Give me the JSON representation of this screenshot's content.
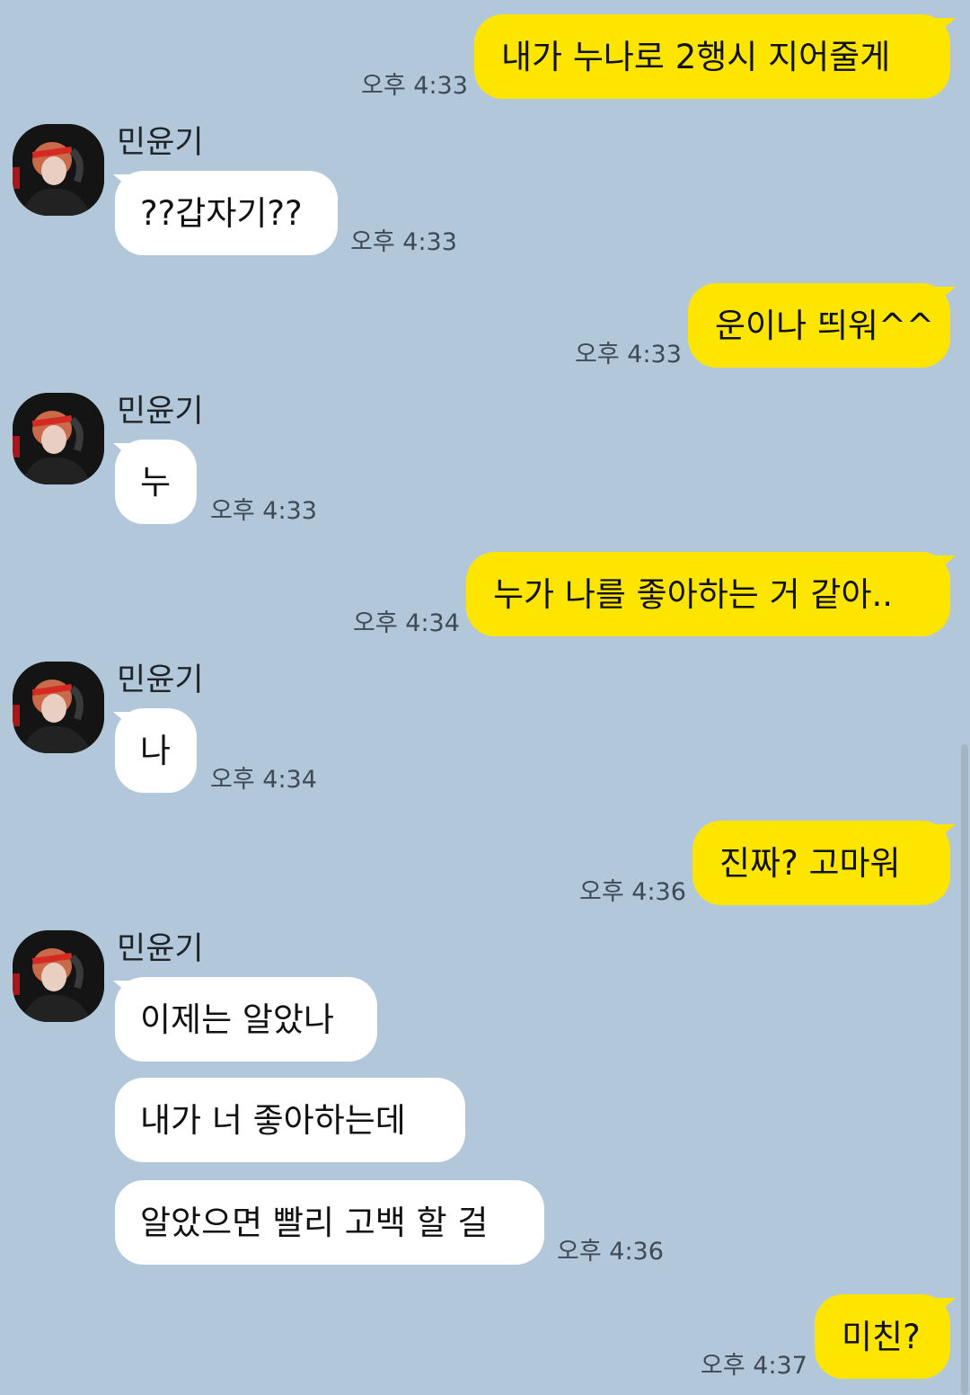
{
  "contact": {
    "name": "민윤기",
    "avatar_icon": "profile-avatar"
  },
  "messages": [
    {
      "sender": "me",
      "text": "내가 누나로 2행시 지어줄게",
      "time": "오후 4:33"
    },
    {
      "sender": "other",
      "text": "??갑자기??",
      "time": "오후 4:33"
    },
    {
      "sender": "me",
      "text": "운이나 띄워^^",
      "time": "오후 4:33"
    },
    {
      "sender": "other",
      "text": "누",
      "time": "오후 4:33"
    },
    {
      "sender": "me",
      "text": "누가 나를 좋아하는 거 같아..",
      "time": "오후 4:34"
    },
    {
      "sender": "other",
      "text": "나",
      "time": "오후 4:34"
    },
    {
      "sender": "me",
      "text": "진짜? 고마워",
      "time": "오후 4:36"
    },
    {
      "sender": "other",
      "text": "이제는 알았나",
      "time": ""
    },
    {
      "sender": "other",
      "text": "내가 너 좋아하는데",
      "time": ""
    },
    {
      "sender": "other",
      "text": "알았으면 빨리 고백 할 걸",
      "time": "오후 4:36"
    },
    {
      "sender": "me",
      "text": "미친?",
      "time": "오후 4:37"
    }
  ],
  "colors": {
    "background": "#b2c7da",
    "my_bubble": "#fee500",
    "other_bubble": "#ffffff"
  }
}
